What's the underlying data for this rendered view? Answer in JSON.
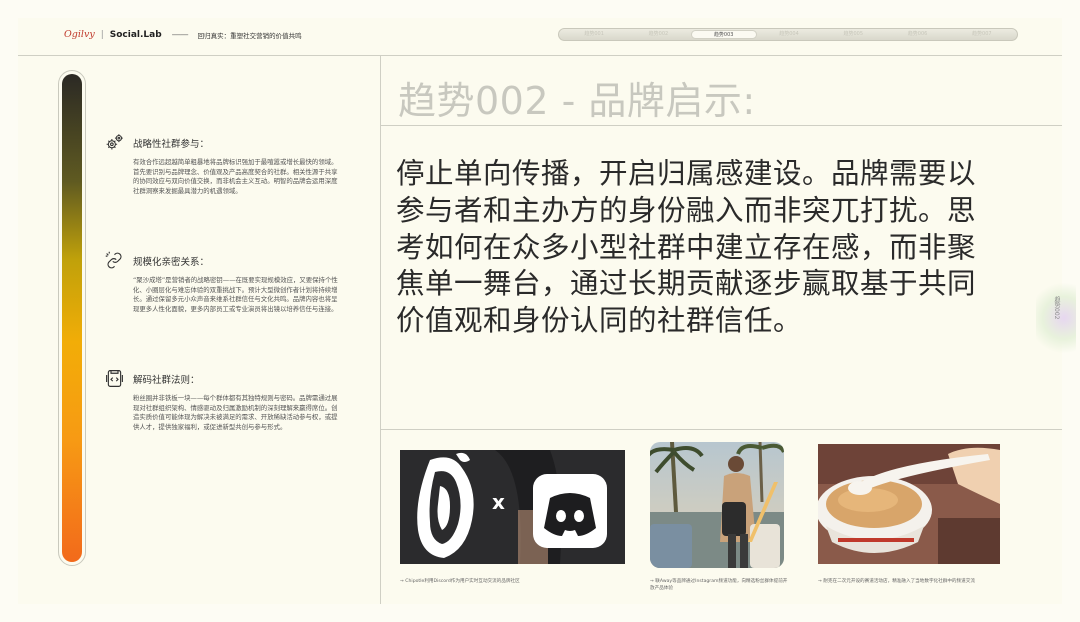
{
  "header": {
    "brand_ogilvy": "Ogilvy",
    "brand_social": "Social.Lab",
    "subtitle": "回归真实：重塑社交营销的价值共鸣",
    "nav_tabs": [
      "趋势001",
      "趋势002",
      "趋势003",
      "趋势004",
      "趋势005",
      "趋势006",
      "趋势007"
    ],
    "nav_active_index": 1
  },
  "left": {
    "sections": [
      {
        "title": "战略性社群参与：",
        "icon": "gears-icon",
        "body": "有效合作远超越简单粗暴地将品牌标识强加于最喧嚣或增长最快的领域。首先要识别与品牌理念、价值观及产品高度契合的社群。相关性源于共享的协同效应与双向价值交换，而非机会主义互动。明智的品牌会运用深度社群洞察来发掘最具潜力的机遇领域。"
      },
      {
        "title": "规模化亲密关系：",
        "icon": "link-icon",
        "body": "“聚沙成塔”是营销者的战略密钥——在既要实现规模效应，又要保持个性化、小圈层化与难忘体验的双重挑战下。预计大型微创作者计划将持续增长。通过保留多元小众声音来维系社群信任与文化共鸣。品牌内容也将呈现更多人性化面貌，更多内部员工或专业演员将出镜以培养信任与连接。"
      },
      {
        "title": "解码社群法则：",
        "icon": "code-icon",
        "body": "粉丝圈并非铁板一块——每个群体都有其独特规则与密码。品牌需通过展现对社群组织架构、情感驱动及归属激励机制的深刻理解来赢得席位。创造实质价值可能体现为解决未被满足的需求、开放稀缺活动参与权，或提供人才，提供独家福利，或促进新型共创与参与形式。"
      }
    ]
  },
  "right": {
    "trend_title": "趋势002 - 品牌启示:",
    "statement": "停止单向传播，开启归属感建设。品牌需要以参与者和主办方的身份融入而非突兀打扰。思考如何在众多小型社群中建立存在感，而非聚焦单一舞台，通过长期贡献逐步赢取基于共同价值观和身份认同的社群信任。",
    "side_tab": "趋势002",
    "photos": [
      {
        "caption": "→ Chipotle利用Discord作为用户实时互动交流的品牌社区",
        "cross": "x"
      },
      {
        "caption": "→ 联Away等品牌通过Instagram频道功能，向精选粉丝群体提前开放产品体验"
      },
      {
        "caption": "→ 耐克在二次元开设的赛道活动店，精准融入了当地数字化社群中的频道交流"
      }
    ]
  }
}
